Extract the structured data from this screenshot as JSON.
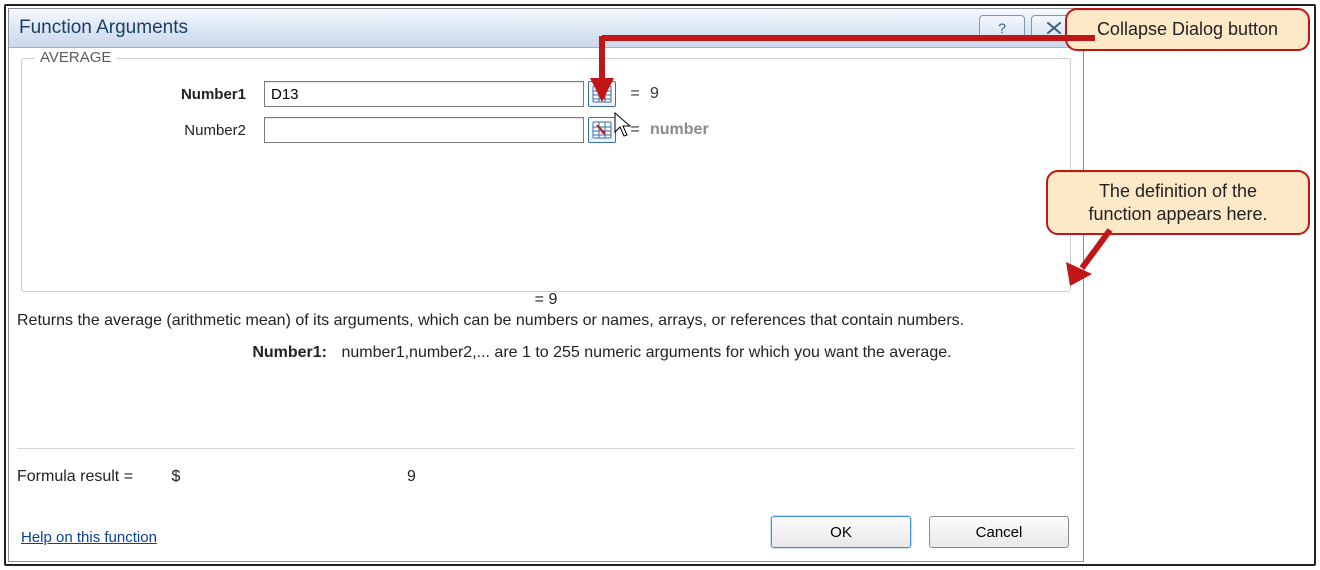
{
  "dialog": {
    "title": "Function Arguments",
    "help_icon_label": "?",
    "group_legend": "AVERAGE",
    "args": [
      {
        "label": "Number1",
        "required": true,
        "value": "D13",
        "placeholder": "",
        "eval": "9",
        "dim": false
      },
      {
        "label": "Number2",
        "required": false,
        "value": "",
        "placeholder": "",
        "eval": "number",
        "dim": true
      }
    ],
    "mid_equals": "=  9",
    "description": "Returns the average (arithmetic mean) of its arguments, which can be numbers or names, arrays, or references that contain numbers.",
    "arg_desc_label": "Number1:",
    "arg_desc_text": "number1,number2,... are 1 to 255 numeric arguments for which you want the average.",
    "result_label": "Formula result =",
    "result_currency": "$",
    "result_value": "9",
    "help_link": "Help on this function",
    "ok_label": "OK",
    "cancel_label": "Cancel"
  },
  "callouts": {
    "c1": "Collapse Dialog button",
    "c2": "The definition of the function appears here."
  },
  "colors": {
    "accent": "#c01616",
    "callout_bg": "#fde8c8",
    "titlebar_text": "#1b3f66"
  }
}
